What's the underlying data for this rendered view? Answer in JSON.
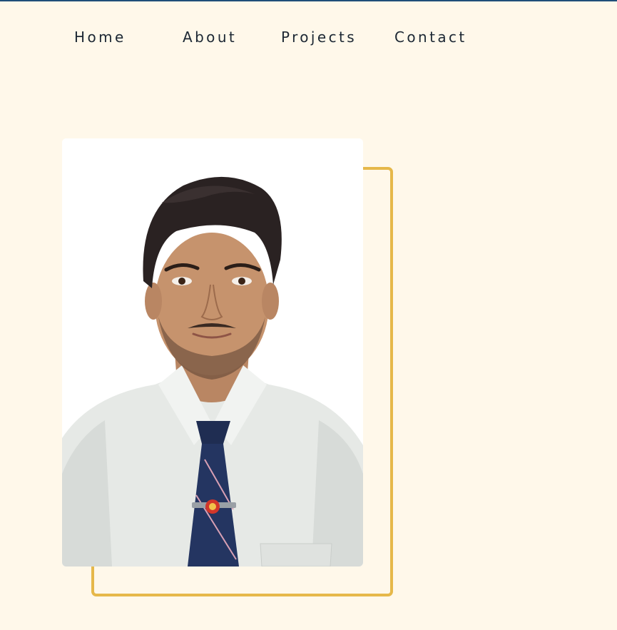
{
  "nav": {
    "items": [
      {
        "label": "Home"
      },
      {
        "label": "About"
      },
      {
        "label": "Projects"
      },
      {
        "label": "Contact"
      }
    ]
  },
  "profile_photo": {
    "subject": "portrait",
    "description": "portrait of a young man in a white shirt and navy tie on white background"
  },
  "colors": {
    "background": "#fff8ea",
    "accent_frame": "#e6b84a",
    "nav_text": "#1c2733",
    "top_rule": "#1f4e79"
  }
}
